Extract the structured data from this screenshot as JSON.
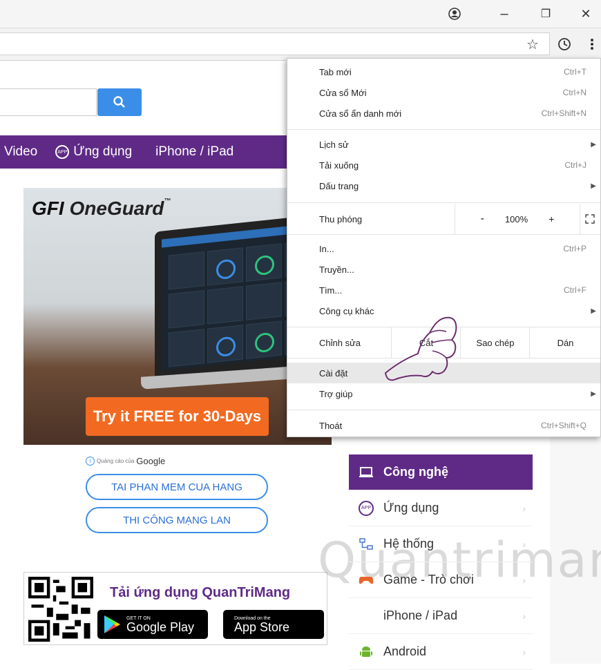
{
  "window": {
    "account_icon": "account-circle-icon",
    "minimize": "–",
    "restore": "❐",
    "close": "✕"
  },
  "toolbar": {
    "star_icon": "star-icon",
    "history_icon": "clock-icon",
    "menu_icon": "three-dot-menu-icon"
  },
  "nav": {
    "items": [
      "Video",
      "Ứng dụng",
      "iPhone / iPad"
    ]
  },
  "ad": {
    "logo_gfi": "GFI",
    "logo_name": "OneGuard",
    "logo_tm": "™",
    "cta": "Try it FREE for 30-Days"
  },
  "google_ad": {
    "label": "Quảng cáo của",
    "brand": "Google",
    "links": [
      "TAI PHAN MEM CUA HANG",
      "THI CÔNG MẠNG LAN"
    ]
  },
  "promo": {
    "title": "Tải ứng dụng QuanTriMang",
    "google_small": "GET IT ON",
    "google_big": "Google Play",
    "apple_small": "Download on the",
    "apple_big": "App Store"
  },
  "categories": [
    {
      "label": "Công nghệ",
      "icon": "laptop-icon"
    },
    {
      "label": "Ứng dụng",
      "icon": "app-icon"
    },
    {
      "label": "Hệ thống",
      "icon": "network-icon"
    },
    {
      "label": "Game - Trò chơi",
      "icon": "gamepad-icon"
    },
    {
      "label": "iPhone / iPad",
      "icon": "apple-icon"
    },
    {
      "label": "Android",
      "icon": "android-icon"
    }
  ],
  "watermark": "Quantrimang",
  "menu": {
    "new_tab": {
      "label": "Tab mới",
      "shortcut": "Ctrl+T"
    },
    "new_window": {
      "label": "Cửa sổ Mới",
      "shortcut": "Ctrl+N"
    },
    "incognito": {
      "label": "Cửa sổ ẩn danh mới",
      "shortcut": "Ctrl+Shift+N"
    },
    "history": {
      "label": "Lịch sử"
    },
    "downloads": {
      "label": "Tải xuống",
      "shortcut": "Ctrl+J"
    },
    "bookmarks": {
      "label": "Dấu trang"
    },
    "zoom": {
      "label": "Thu phóng",
      "minus": "-",
      "value": "100%",
      "plus": "+"
    },
    "print": {
      "label": "In...",
      "shortcut": "Ctrl+P"
    },
    "cast": {
      "label": "Truyền..."
    },
    "find": {
      "label": "Tìm...",
      "shortcut": "Ctrl+F"
    },
    "more_tools": {
      "label": "Công cụ khác"
    },
    "edit": {
      "label": "Chỉnh sửa",
      "cut": "Cắt",
      "copy": "Sao chép",
      "paste": "Dán"
    },
    "settings": {
      "label": "Cài đặt"
    },
    "help": {
      "label": "Trợ giúp"
    },
    "exit": {
      "label": "Thoát",
      "shortcut": "Ctrl+Shift+Q"
    }
  }
}
